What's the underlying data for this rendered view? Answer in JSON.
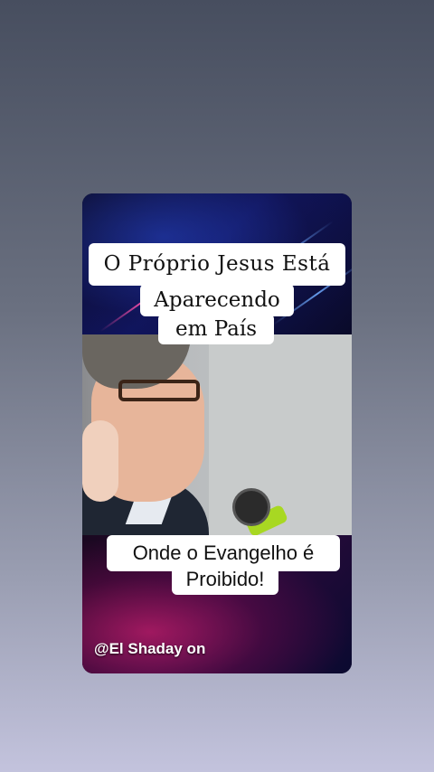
{
  "video": {
    "title_lines": [
      "O Próprio Jesus Está",
      "Aparecendo",
      "em País"
    ],
    "subtitle_lines": [
      "Onde o Evangelho é",
      "Proibido!"
    ],
    "channel_handle": "@El Shaday on"
  },
  "colors": {
    "page_gradient_top": "#474e5f",
    "page_gradient_bottom": "#c3c3dd",
    "caption_background": "#ffffff",
    "caption_text": "#111111",
    "accent_blue": "#1e2ca0",
    "accent_magenta": "#c81e6e"
  }
}
